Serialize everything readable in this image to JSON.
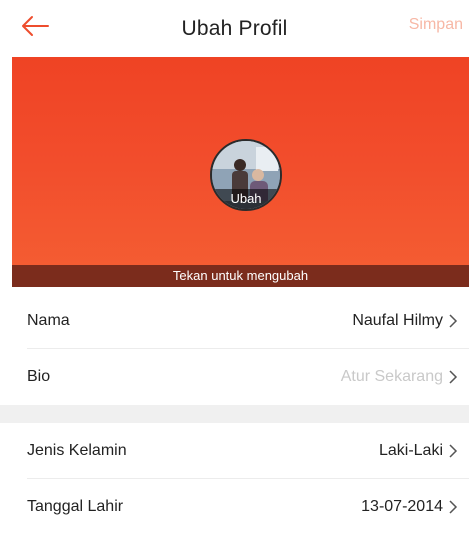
{
  "header": {
    "back_icon": "arrow-left-icon",
    "title": "Ubah Profil",
    "save_label": "Simpan",
    "accent_color": "#ee4d2d"
  },
  "banner": {
    "avatar_label": "Ubah",
    "hint": "Tekan untuk mengubah"
  },
  "fields": [
    {
      "label": "Nama",
      "value": "Naufal Hilmy"
    },
    {
      "label": "Bio",
      "value": "Atur Sekarang"
    },
    {
      "label": "Jenis Kelamin",
      "value": "Laki-Laki"
    },
    {
      "label": "Tanggal Lahir",
      "value": "13-07-2014"
    }
  ]
}
